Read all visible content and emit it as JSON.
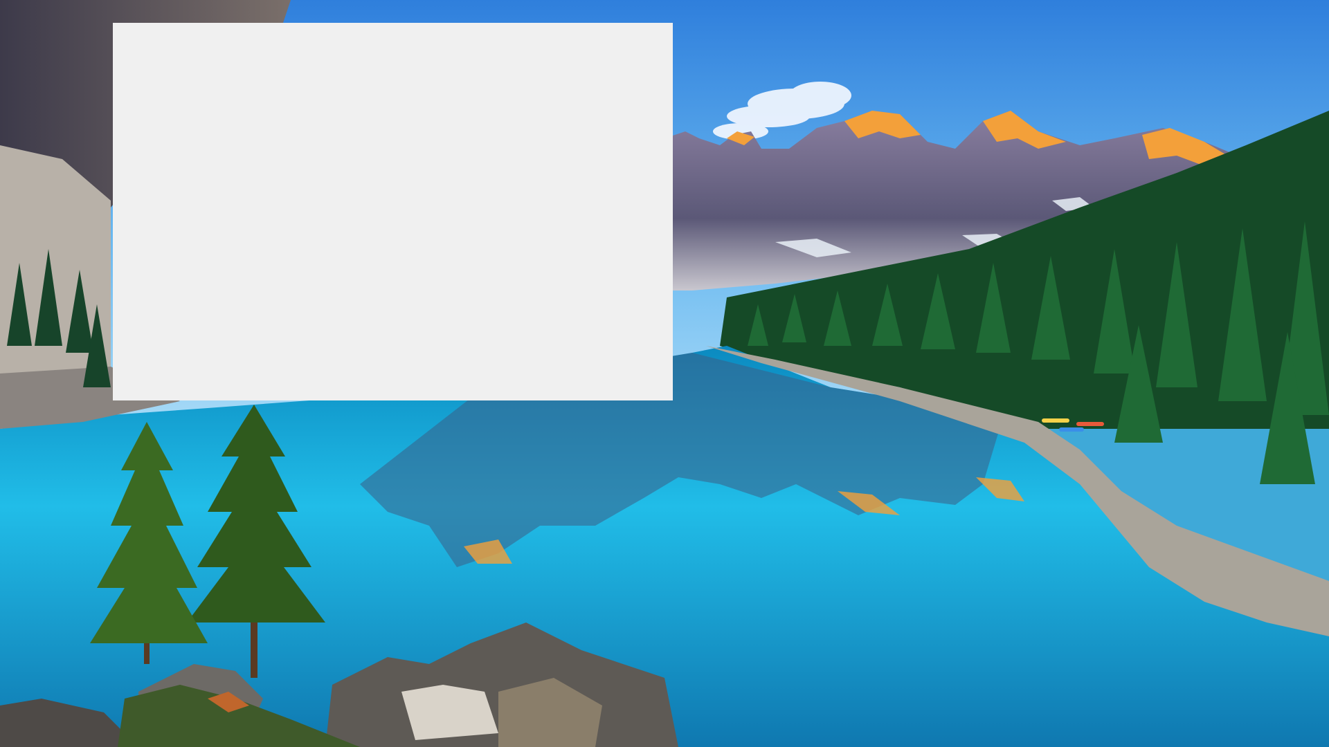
{
  "screen": {
    "description_type": "desktop-wallpaper-with-blank-window"
  },
  "wallpaper": {
    "subject": "mountain-lake-landscape",
    "colors": {
      "sky_top": "#3f8fe0",
      "sky_bottom": "#9fd4f5",
      "mountain_rock": "#6e6a86",
      "mountain_shadow": "#4b4a68",
      "peak_glow": "#f3a03a",
      "snow": "#e8eef6",
      "forest_dark": "#123d22",
      "forest_mid": "#1f6a35",
      "lake_deep": "#0f7fb7",
      "lake_light": "#27c6ee",
      "shore": "#a9a49a",
      "rocks": "#6d6a66",
      "cloud": "#f2f7ff"
    }
  },
  "window": {
    "background": "#f0f0f0",
    "content": ""
  }
}
